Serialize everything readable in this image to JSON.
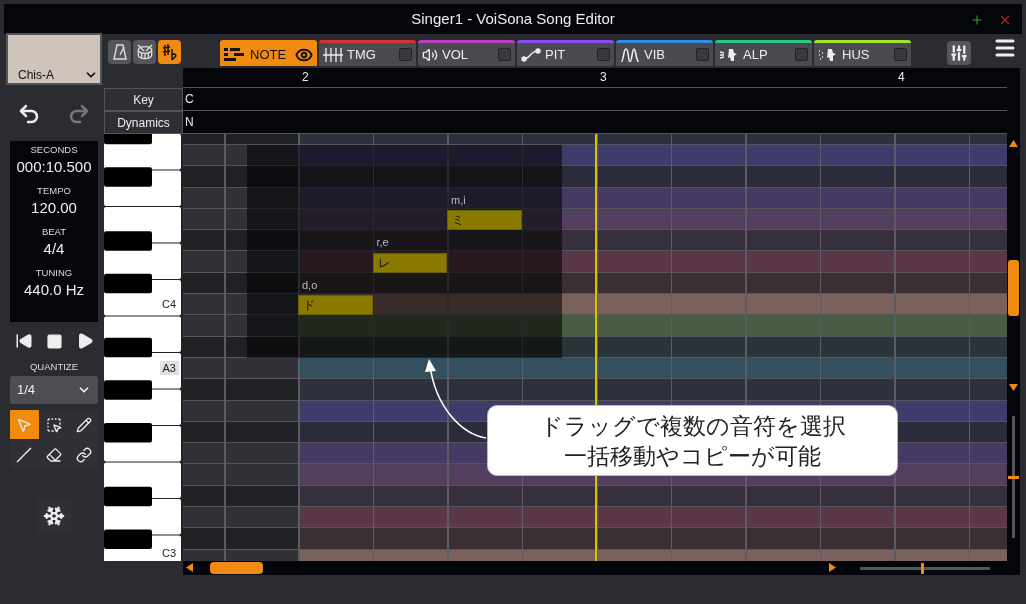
{
  "window": {
    "title": "Singer1 - VoiSona Song Editor"
  },
  "singer": {
    "name": "Chis-A"
  },
  "toggles": [
    {
      "on": false
    },
    {
      "on": false
    },
    {
      "on": true
    }
  ],
  "info": [
    {
      "label": "SECONDS",
      "value": "000:10.500"
    },
    {
      "label": "TEMPO",
      "value": "120.00"
    },
    {
      "label": "BEAT",
      "value": "4/4"
    },
    {
      "label": "TUNING",
      "value": "440.0 Hz"
    }
  ],
  "quantize": {
    "label": "QUANTIZE",
    "value": "1/4"
  },
  "tools": [
    {
      "selected": true
    },
    {
      "selected": false
    },
    {
      "selected": false
    },
    {
      "selected": false
    },
    {
      "selected": false
    },
    {
      "selected": false
    }
  ],
  "tabs": [
    {
      "label": "NOTE",
      "selected": true,
      "color": "#f08a10"
    },
    {
      "label": "TMG",
      "selected": false,
      "checked": false,
      "color": "#d9342b"
    },
    {
      "label": "VOL",
      "selected": false,
      "checked": false,
      "color": "#c23fc2"
    },
    {
      "label": "PIT",
      "selected": false,
      "checked": false,
      "color": "#8a4bf0"
    },
    {
      "label": "VIB",
      "selected": false,
      "checked": false,
      "color": "#2f8ee0"
    },
    {
      "label": "ALP",
      "selected": false,
      "checked": false,
      "color": "#2ec78a"
    },
    {
      "label": "HUS",
      "selected": false,
      "checked": false,
      "color": "#a6e02a"
    }
  ],
  "ruler": {
    "measures": [
      "2",
      "3",
      "4"
    ]
  },
  "tracks": [
    {
      "label": "Key",
      "value": "C"
    },
    {
      "label": "Dynamics",
      "value": "N"
    }
  ],
  "piano": {
    "key_labels": [
      {
        "text": "C4",
        "highlighted": false
      },
      {
        "text": "A3",
        "highlighted": true
      },
      {
        "text": "C3",
        "highlighted": false
      }
    ]
  },
  "notes": [
    {
      "lyric": "ド",
      "phonemes": "d,o"
    },
    {
      "lyric": "レ",
      "phonemes": "r,e"
    },
    {
      "lyric": "ミ",
      "phonemes": "m,i"
    }
  ],
  "zoom": {
    "vertical": {
      "level": 0.5
    },
    "horizontal": {
      "level": 0.48
    }
  },
  "callout": {
    "lines": [
      "ドラッグで複数の音符を選択",
      "一括移動やコピーが可能"
    ]
  }
}
